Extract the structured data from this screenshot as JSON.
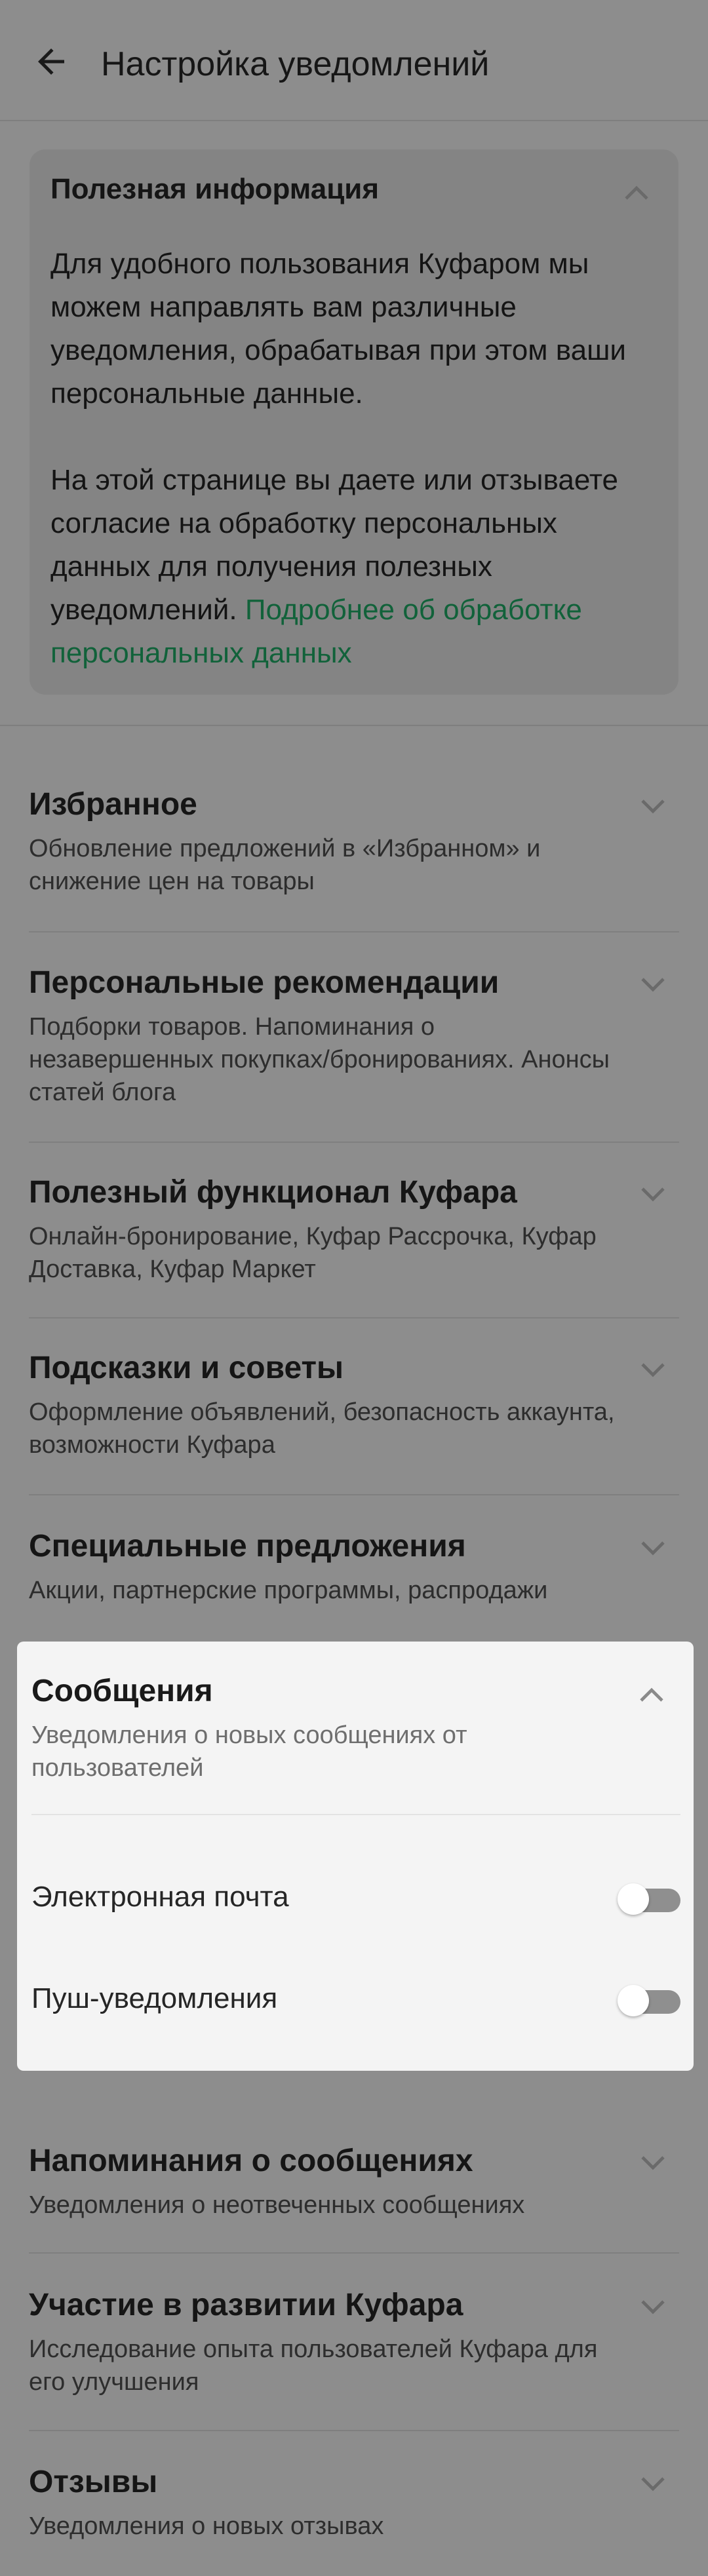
{
  "header": {
    "title": "Настройка уведомлений"
  },
  "info": {
    "title": "Полезная информация",
    "para1": "Для удобного пользования Куфаром мы можем направлять вам различные уведомления, обрабатывая при этом ваши персональные данные.",
    "para2": "На этой странице вы даете или отзываете согласие на обработку персональных данных для получения полезных уведомлений.",
    "link": "Подробнее об обработке персональных данных"
  },
  "sections": [
    {
      "title": "Избранное",
      "subtitle": "Обновление предложений в «Избранном» и снижение цен на товары"
    },
    {
      "title": "Персональные рекомендации",
      "subtitle": "Подборки товаров. Напоминания о незавершенных покупках/бронированиях. Анонсы статей блога"
    },
    {
      "title": "Полезный функционал Куфара",
      "subtitle": "Онлайн-бронирование, Куфар Рассрочка, Куфар Доставка, Куфар Маркет"
    },
    {
      "title": "Подсказки и советы",
      "subtitle": "Оформление объявлений, безопасность аккаунта, возможности Куфара"
    },
    {
      "title": "Специальные предложения",
      "subtitle": "Акции, партнерские программы, распродажи"
    },
    {
      "title": "Сообщения",
      "subtitle": "Уведомления о новых сообщениях от пользователей"
    },
    {
      "title": "Напоминания о сообщениях",
      "subtitle": "Уведомления о неотвеченных сообщениях"
    },
    {
      "title": "Участие в развитии Куфара",
      "subtitle": "Исследование опыта пользователей Куфара для его улучшения"
    },
    {
      "title": "Отзывы",
      "subtitle": "Уведомления о новых отзывах"
    }
  ],
  "messages_options": [
    {
      "label": "Электронная почта",
      "enabled": false
    },
    {
      "label": "Пуш-уведомления",
      "enabled": false
    }
  ]
}
